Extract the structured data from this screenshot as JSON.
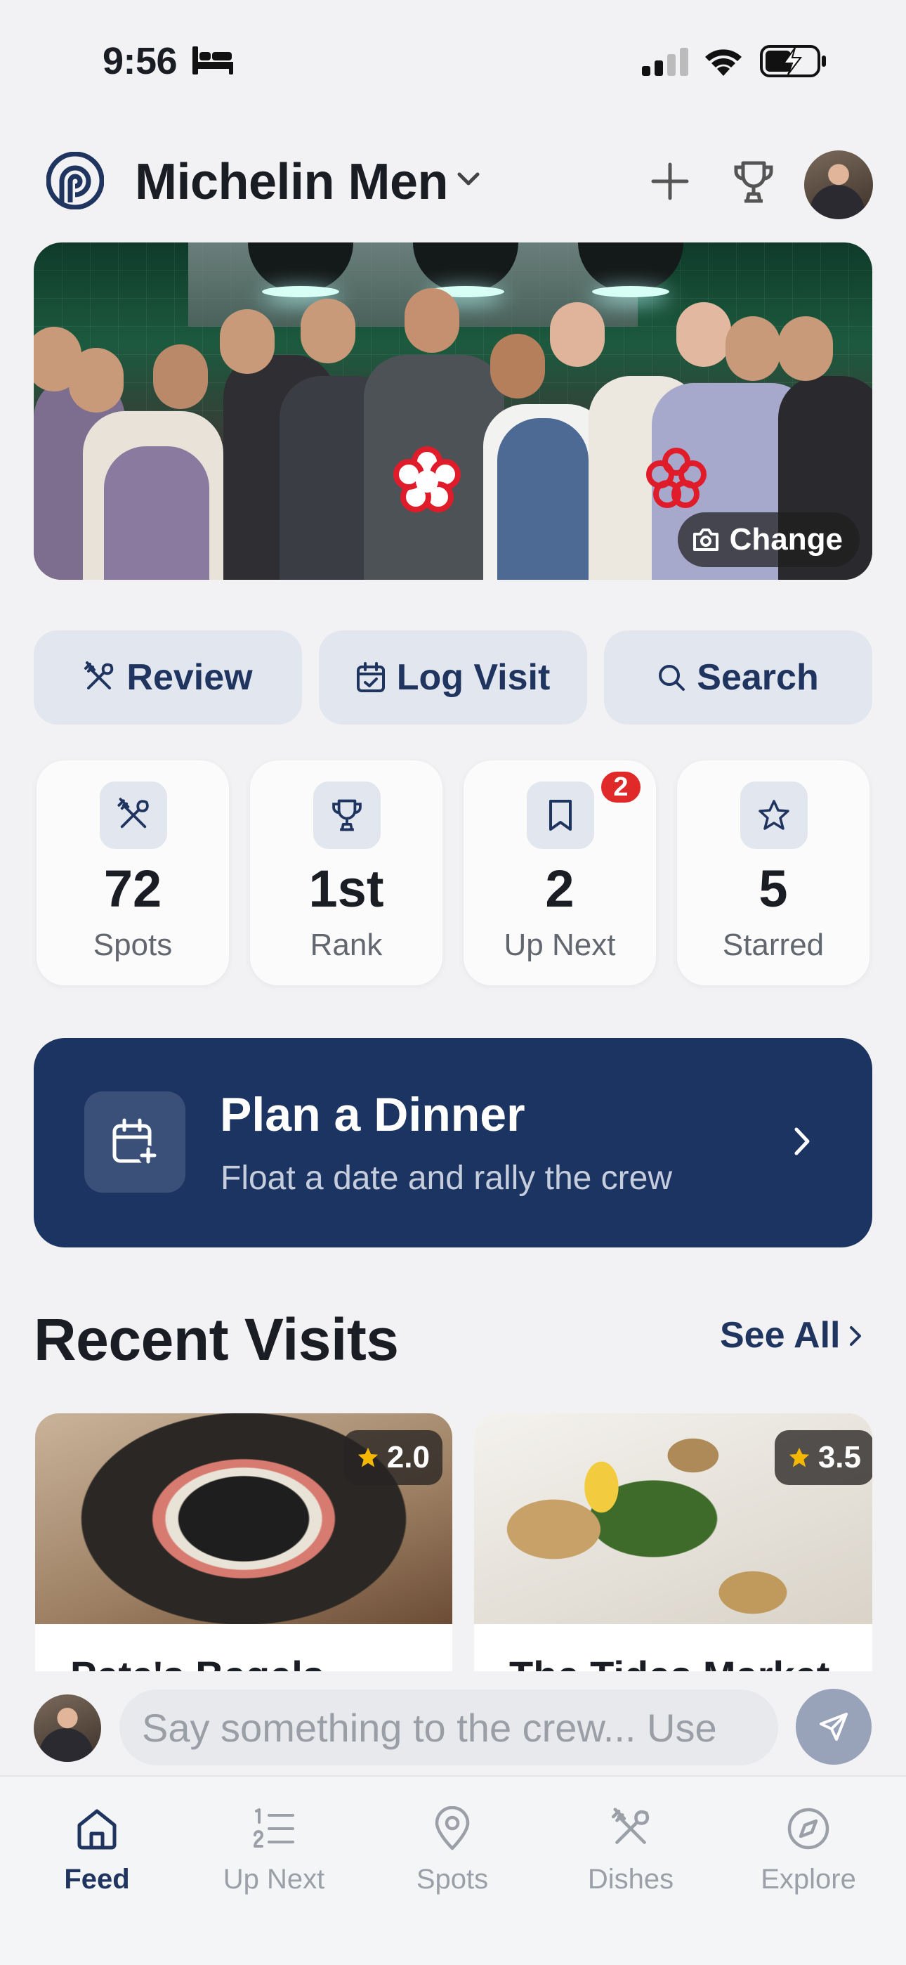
{
  "status_bar": {
    "time": "9:56"
  },
  "header": {
    "group_name": "Michelin Men"
  },
  "hero": {
    "change_label": "Change"
  },
  "actions": [
    {
      "label": "Review",
      "icon": "utensils-icon"
    },
    {
      "label": "Log Visit",
      "icon": "calendar-check-icon"
    },
    {
      "label": "Search",
      "icon": "search-icon"
    }
  ],
  "stats": [
    {
      "value": "72",
      "label": "Spots",
      "icon": "utensils-icon"
    },
    {
      "value": "1st",
      "label": "Rank",
      "icon": "trophy-icon"
    },
    {
      "value": "2",
      "label": "Up Next",
      "icon": "bookmark-icon",
      "badge": "2"
    },
    {
      "value": "5",
      "label": "Starred",
      "icon": "star-icon"
    }
  ],
  "plan": {
    "title": "Plan a Dinner",
    "subtitle": "Float a date and rally the crew"
  },
  "recent": {
    "title": "Recent Visits",
    "see_all": "See All",
    "cards": [
      {
        "name": "Pete's Bagels",
        "rating": "2.0"
      },
      {
        "name": "The Tides Market",
        "rating": "3.5"
      }
    ]
  },
  "composer": {
    "placeholder": "Say something to the crew... Use"
  },
  "tabs": [
    {
      "label": "Feed",
      "icon": "home-icon",
      "active": true
    },
    {
      "label": "Up Next",
      "icon": "numbered-list-icon"
    },
    {
      "label": "Spots",
      "icon": "map-pin-icon"
    },
    {
      "label": "Dishes",
      "icon": "utensils-icon"
    },
    {
      "label": "Explore",
      "icon": "compass-icon"
    }
  ],
  "colors": {
    "navy": "#1c3461",
    "accent_text": "#1f3560",
    "badge_red": "#e02a2a",
    "star": "#f5b800"
  }
}
